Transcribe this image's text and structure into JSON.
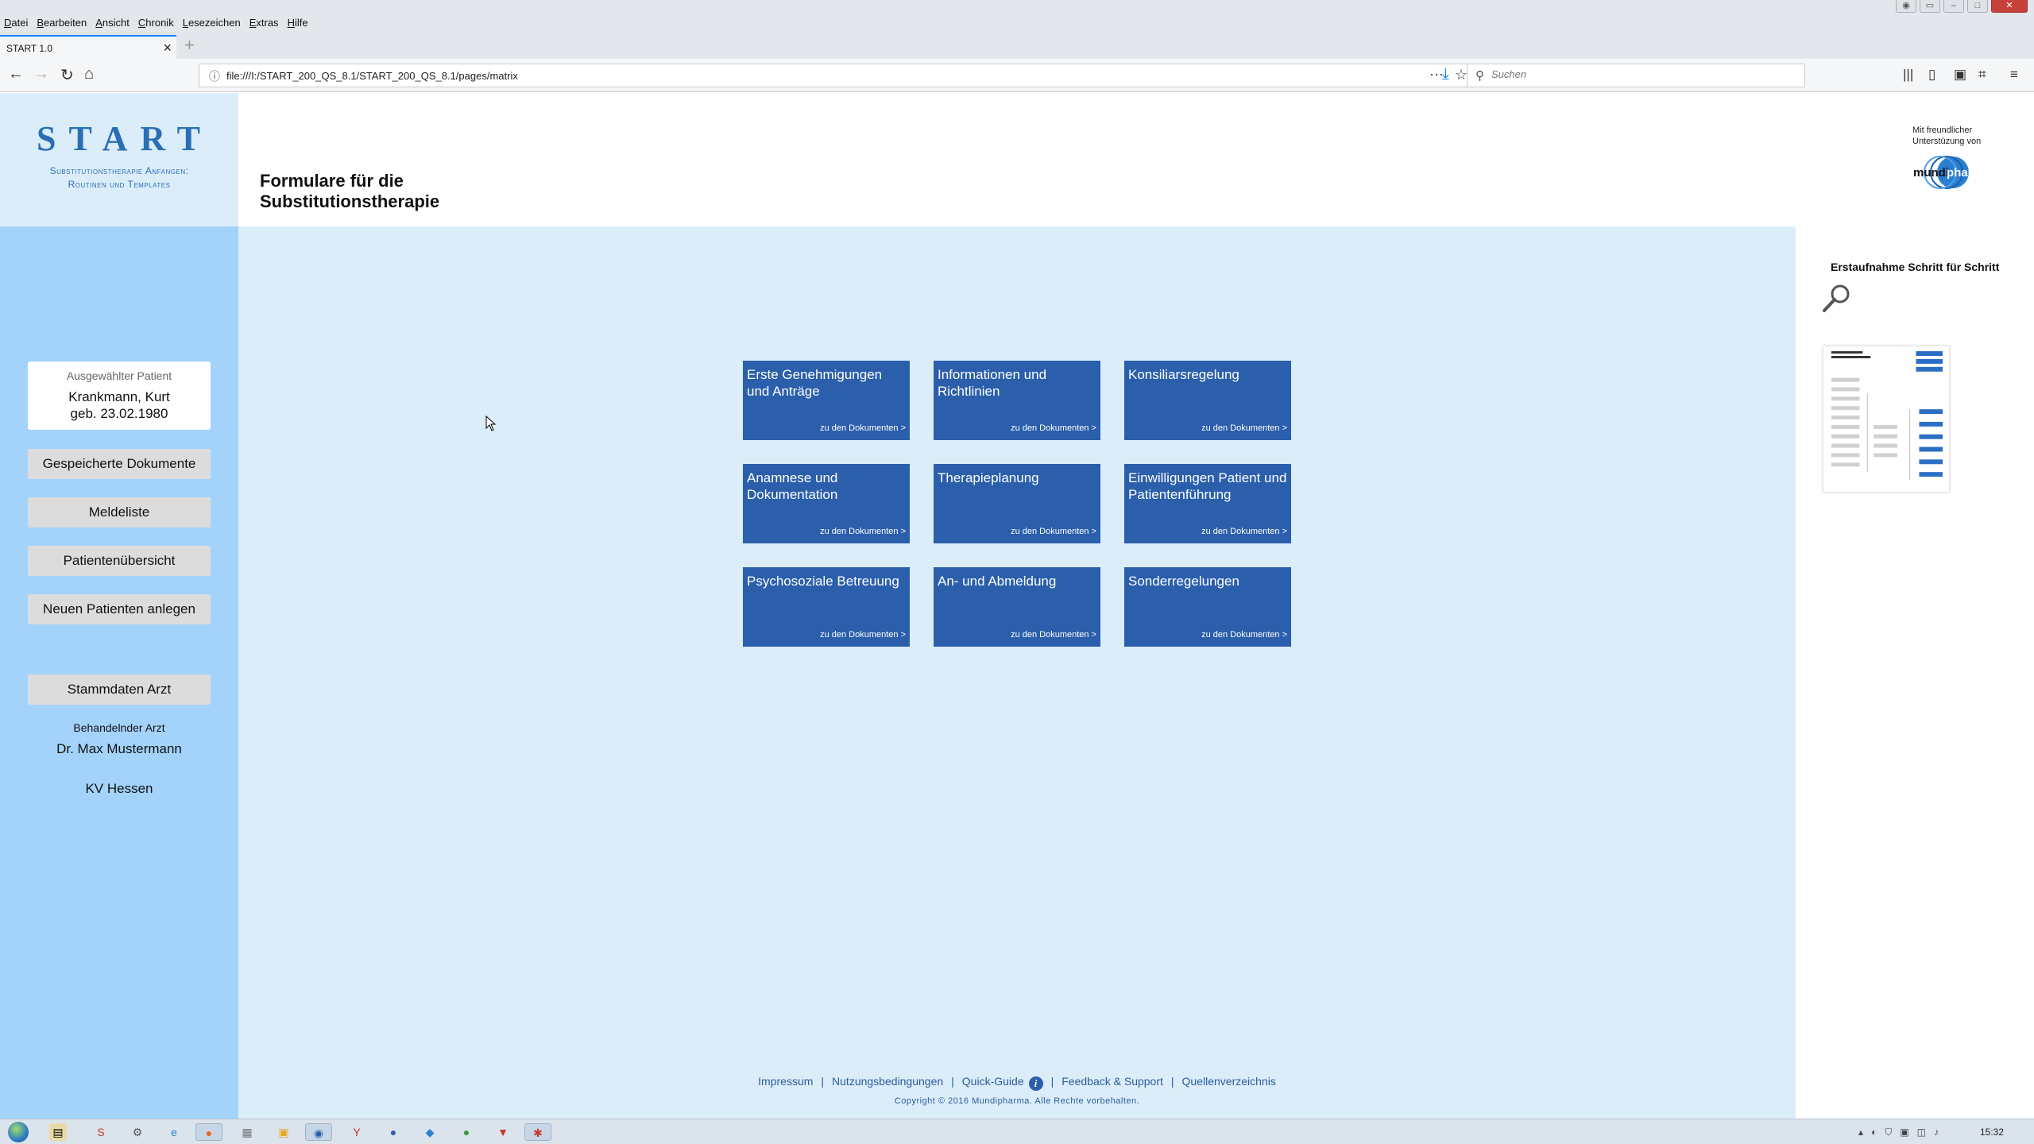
{
  "browser": {
    "menus": [
      "Datei",
      "Bearbeiten",
      "Ansicht",
      "Chronik",
      "Lesezeichen",
      "Extras",
      "Hilfe"
    ],
    "tab_title": "START 1.0",
    "url": "file:///I:/START_200_QS_8.1/START_200_QS_8.1/pages/matrix",
    "search_placeholder": "Suchen"
  },
  "logo": {
    "title": "START",
    "subtitle_line1": "Substitutionstherapie Anfangen:",
    "subtitle_line2": "Routinen und Templates"
  },
  "header": {
    "title": "Formulare für die\nSubstitutionstherapie",
    "sponsor_text": "Mit freundlicher\nUnterstüzung von",
    "sponsor_logo_text": "mundipharma"
  },
  "sidebar": {
    "patient_label": "Ausgewählter Patient",
    "patient_name": "Krankmann, Kurt",
    "patient_dob": "geb. 23.02.1980",
    "buttons": [
      "Gespeicherte Dokumente",
      "Meldeliste",
      "Patientenübersicht",
      "Neuen Patienten anlegen"
    ],
    "doctor_button": "Stammdaten Arzt",
    "doctor_label": "Behandelnder Arzt",
    "doctor_name": "Dr. Max Mustermann",
    "kv": "KV Hessen"
  },
  "right_panel": {
    "title": "Erstaufnahme Schritt für Schritt"
  },
  "tiles": [
    {
      "title": "Erste Genehmigungen und Anträge",
      "link": "zu den Dokumenten >"
    },
    {
      "title": "Informationen und Richtlinien",
      "link": "zu den Dokumenten >"
    },
    {
      "title": "Konsiliarsregelung",
      "link": "zu den Dokumenten >"
    },
    {
      "title": "Anamnese und Dokumentation",
      "link": "zu den Dokumenten >"
    },
    {
      "title": "Therapieplanung",
      "link": "zu den Dokumenten >"
    },
    {
      "title": "Einwilligungen Patient und Patientenführung",
      "link": "zu den Dokumenten >"
    },
    {
      "title": "Psychosoziale Betreuung",
      "link": "zu den Dokumenten >"
    },
    {
      "title": "An- und Abmeldung",
      "link": "zu den Dokumenten >"
    },
    {
      "title": "Sonderregelungen",
      "link": "zu den Dokumenten >"
    }
  ],
  "footer": {
    "links": [
      "Impressum",
      "Nutzungsbedingungen",
      "Quick-Guide",
      "Feedback & Support",
      "Quellenverzeichnis"
    ],
    "copyright": "Copyright © 2016 Mundipharma. Alle Rechte vorbehalten."
  },
  "taskbar": {
    "clock": "15:32"
  },
  "colors": {
    "tile_blue": "#2b5fab",
    "sidebar_blue": "#a3d3fb",
    "page_bg": "#dcedfa",
    "logo_blue": "#2a6fb5"
  }
}
